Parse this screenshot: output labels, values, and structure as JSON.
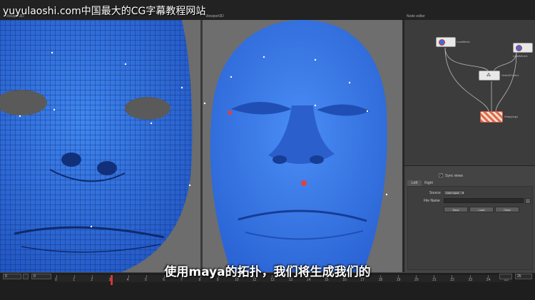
{
  "watermark": "yuyulaoshi.com中国最大的CG字幕教程网站",
  "viewport_labels": [
    "Viewport3D",
    "Viewport3D",
    "Node editor"
  ],
  "subtitle": "使用maya的拓扑，我们将生成我们的",
  "colors": {
    "face_blue": "#3d7be3",
    "viewport_bg": "#6d6d6d",
    "panel_bg": "#3c3c3c",
    "playhead": "#e03030"
  },
  "nodes": [
    {
      "label": "LoadMesh"
    },
    {
      "label": "LoadMesh1"
    },
    {
      "label": "SelectPoints1"
    },
    {
      "label": "Wrapping1"
    }
  ],
  "properties": {
    "sync_views": "Sync views",
    "tabs": [
      "Left",
      "Right"
    ],
    "source_label": "Source",
    "source_value": "User input",
    "file_name_label": "File Name",
    "buttons": [
      "Save",
      "Load",
      "Clear"
    ]
  },
  "timeline": {
    "start": "0",
    "current": "0",
    "end": "25",
    "ticks": [
      "0",
      "1",
      "2",
      "3",
      "4",
      "5",
      "6",
      "7",
      "8",
      "9",
      "10",
      "11",
      "12",
      "13",
      "14",
      "15",
      "16",
      "17",
      "18",
      "19",
      "20",
      "21",
      "22",
      "23",
      "24",
      "25"
    ]
  }
}
